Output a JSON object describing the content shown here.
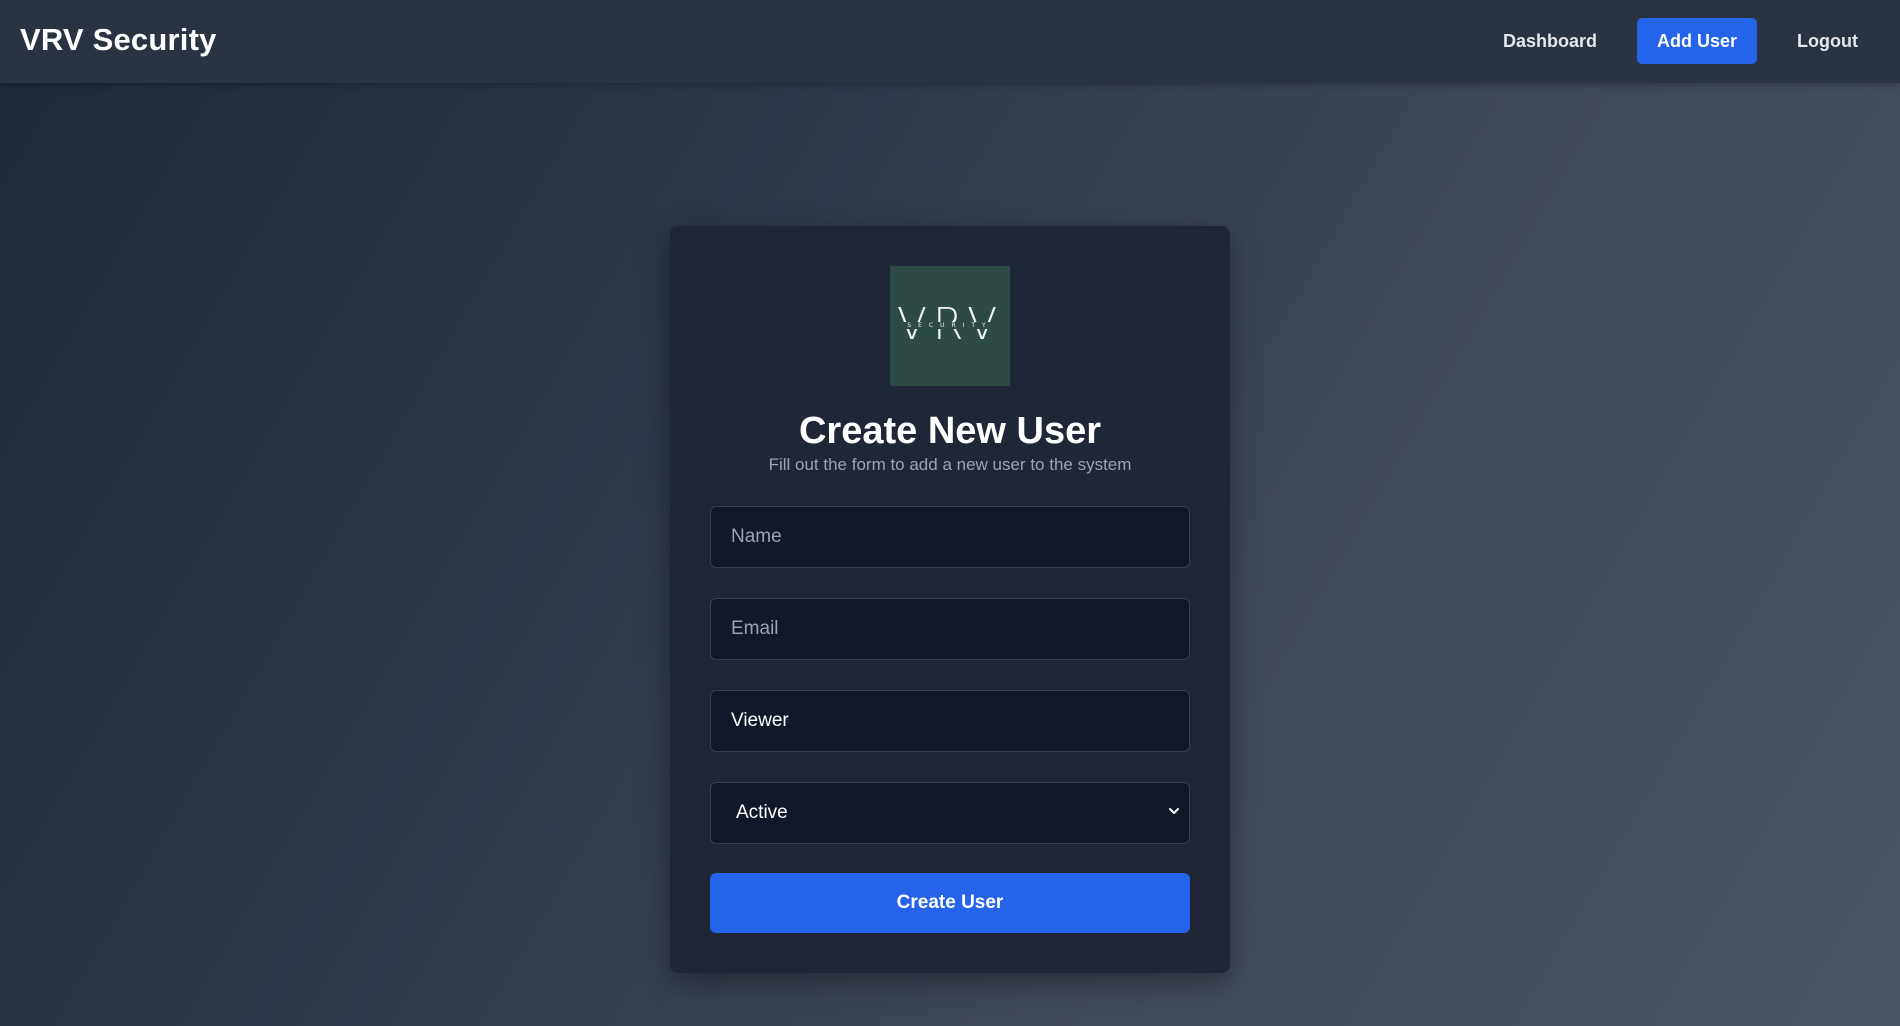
{
  "app": {
    "brand": "VRV Security"
  },
  "nav": {
    "items": [
      {
        "label": "Dashboard",
        "active": false
      },
      {
        "label": "Add User",
        "active": true
      },
      {
        "label": "Logout",
        "active": false
      }
    ]
  },
  "form": {
    "logo": {
      "text": "VRV",
      "subtext": "SECURITY",
      "background": "#2e4a44"
    },
    "title": "Create New User",
    "subtitle": "Fill out the form to add a new user to the system",
    "name_field": {
      "placeholder": "Name",
      "value": ""
    },
    "email_field": {
      "placeholder": "Email",
      "value": ""
    },
    "role_field": {
      "value": "Viewer"
    },
    "status_select": {
      "value": "Active",
      "icon": "chevron-down-icon"
    },
    "submit_label": "Create User"
  },
  "colors": {
    "accent": "#2563eb",
    "card_bg": "#1f2737",
    "input_bg": "#111827",
    "navbar_bg": "#2a3342"
  }
}
